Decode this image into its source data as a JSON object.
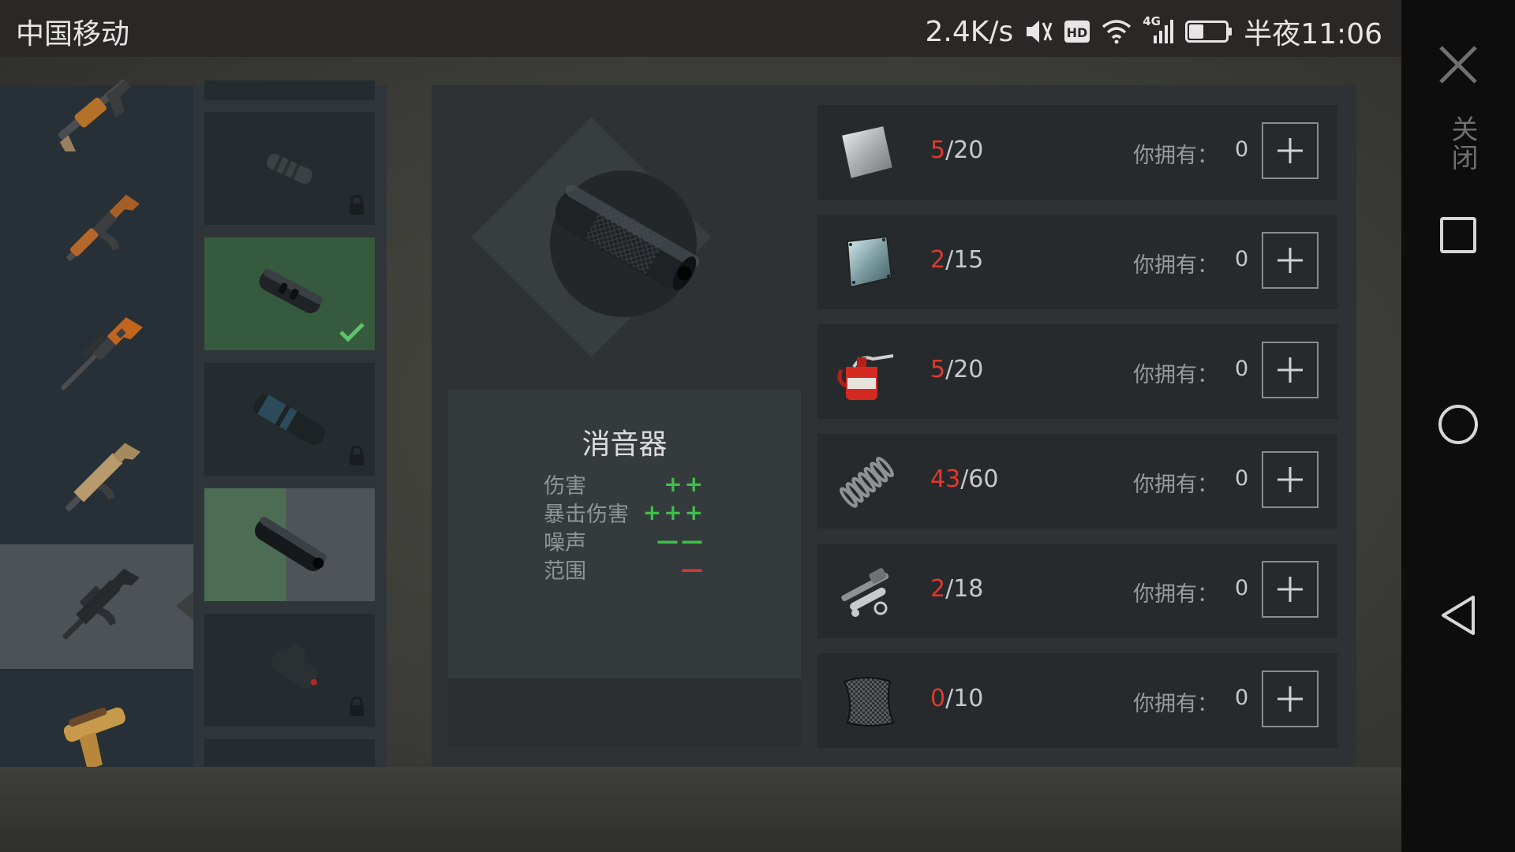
{
  "status_bar": {
    "carrier": "中国移动",
    "net_speed": "2.4K/s",
    "network_type": "4G",
    "time": "半夜11:06",
    "icons": [
      "mute-icon",
      "hd-icon",
      "wifi-icon",
      "signal-icon",
      "battery-icon"
    ],
    "battery_level": 0.4
  },
  "nav_bar": {
    "close_label": "关闭",
    "buttons": [
      "close-icon",
      "recent-apps-icon",
      "home-icon",
      "back-icon"
    ]
  },
  "weapons": [
    {
      "name": "shotgun-icon",
      "selected": false
    },
    {
      "name": "ak-rifle-icon",
      "selected": false
    },
    {
      "name": "sniper-rifle-icon",
      "selected": false
    },
    {
      "name": "scar-rifle-icon",
      "selected": false
    },
    {
      "name": "m16-rifle-icon",
      "selected": true
    },
    {
      "name": "flare-pistol-icon",
      "selected": false
    }
  ],
  "attachments": [
    {
      "name": "compensator-icon",
      "state": "locked"
    },
    {
      "name": "muzzle-brake-icon",
      "state": "equipped"
    },
    {
      "name": "blue-suppressor-icon",
      "state": "locked"
    },
    {
      "name": "silencer-icon",
      "state": "selected"
    },
    {
      "name": "laser-sight-icon",
      "state": "locked"
    }
  ],
  "preview": {
    "item_name": "消音器",
    "stats": [
      {
        "label": "伤害",
        "value": "++",
        "color": "#3fbf4a"
      },
      {
        "label": "暴击伤害",
        "value": "+++",
        "color": "#3fbf4a"
      },
      {
        "label": "噪声",
        "value": "——",
        "color": "#3fbf4a"
      },
      {
        "label": "范围",
        "value": "—",
        "color": "#d23b30"
      }
    ]
  },
  "materials": {
    "own_label": "你拥有：",
    "items": [
      {
        "icon": "steel-plate-icon",
        "have": "5",
        "sep": "/",
        "need": "20",
        "owned": "0"
      },
      {
        "icon": "glass-plate-icon",
        "have": "2",
        "sep": "/",
        "need": "15",
        "owned": "0"
      },
      {
        "icon": "oil-can-icon",
        "have": "5",
        "sep": "/",
        "need": "20",
        "owned": "0"
      },
      {
        "icon": "spring-icon",
        "have": "43",
        "sep": "/",
        "need": "60",
        "owned": "0"
      },
      {
        "icon": "gun-parts-icon",
        "have": "2",
        "sep": "/",
        "need": "18",
        "owned": "0"
      },
      {
        "icon": "carbon-fiber-icon",
        "have": "0",
        "sep": "/",
        "need": "10",
        "owned": "0"
      }
    ]
  }
}
